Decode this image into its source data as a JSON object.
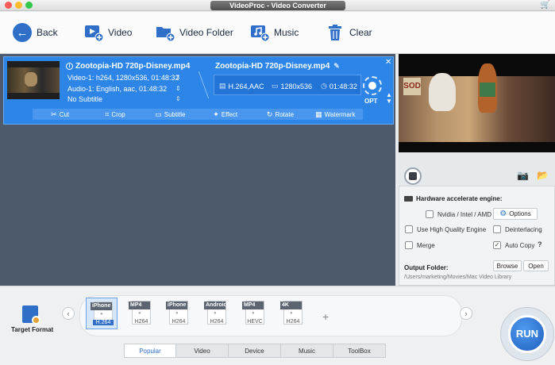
{
  "window": {
    "title": "VideoProc - Video Converter"
  },
  "toolbar": {
    "back": "Back",
    "video": "Video",
    "video_folder": "Video Folder",
    "music": "Music",
    "clear": "Clear"
  },
  "task": {
    "source_file": "Zootopia-HD 720p-Disney.mp4",
    "video_info": "Video-1: h264, 1280x536, 01:48:32",
    "audio_info": "Audio-1: English, aac, 01:48:32",
    "subtitle_info": "No Subtitle",
    "output_file": "Zootopia-HD 720p-Disney.mp4",
    "output_codec": "H.264,AAC",
    "output_resolution": "1280x536",
    "output_duration": "01:48:32",
    "opt_label": "OPT",
    "edit_tools": [
      "Cut",
      "Crop",
      "Subtitle",
      "Effect",
      "Rotate",
      "Watermark"
    ]
  },
  "preview": {
    "sign_text": "SOD"
  },
  "settings": {
    "hw_label": "Hardware accelerate engine:",
    "nvidia_label": "Nvidia / Intel / AMD",
    "options_button": "Options",
    "high_quality": "Use High Quality Engine",
    "deinterlacing": "Deinterlacing",
    "merge": "Merge",
    "auto_copy": "Auto Copy",
    "auto_copy_checked": true,
    "help": "?",
    "output_folder_label": "Output Folder:",
    "browse": "Browse",
    "open": "Open",
    "output_path": "/Users/marketing/Movies/Mac Video Library"
  },
  "bottom": {
    "target_format_label": "Target Format",
    "formats": [
      {
        "top": "iPhone",
        "codec": "H.264",
        "selected": true
      },
      {
        "top": "MP4",
        "codec": "H264",
        "selected": false
      },
      {
        "top": "iPhone",
        "codec": "H264",
        "selected": false
      },
      {
        "top": "Android",
        "codec": "H264",
        "selected": false
      },
      {
        "top": "MP4",
        "codec": "HEVC",
        "selected": false
      },
      {
        "top": "4K",
        "codec": "H264",
        "selected": false
      }
    ],
    "add": "+",
    "tabs": [
      "Popular",
      "Video",
      "Device",
      "Music",
      "ToolBox"
    ],
    "active_tab": "Popular",
    "run": "RUN"
  },
  "colors": {
    "accent": "#2d85e8",
    "task_bg": "#4d5a6b",
    "run": "#1f5fbf"
  }
}
